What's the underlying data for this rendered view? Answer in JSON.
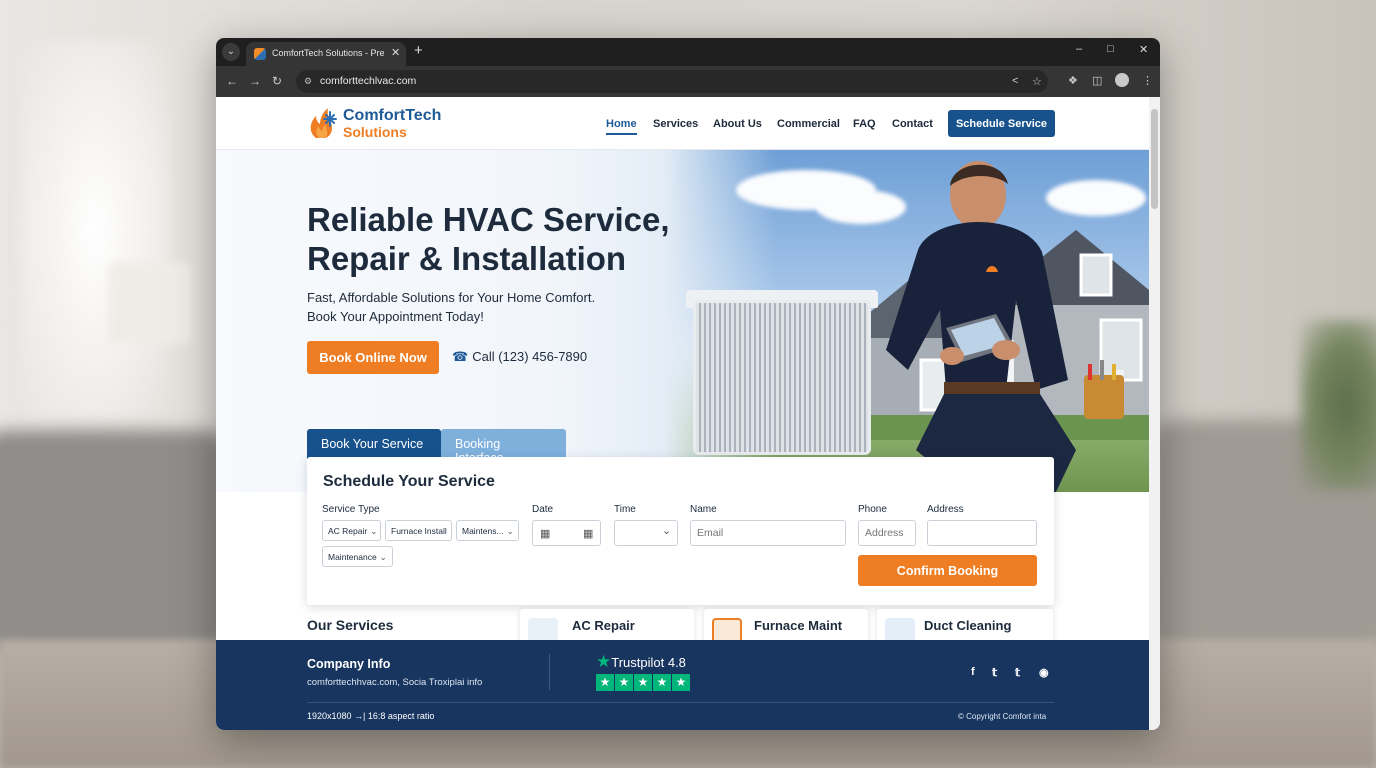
{
  "browser": {
    "tab_title": "ComfortTech Solutions - Premier",
    "url": "comforttechlvac.com"
  },
  "brand": {
    "name_line1": "ComfortTech",
    "name_line2": "Solutions",
    "primary_color": "#17528d",
    "accent_color": "#ef7d23"
  },
  "nav": {
    "items": [
      "Home",
      "Services",
      "About Us",
      "Commercial",
      "FAQ",
      "Contact"
    ],
    "active": "Home",
    "cta_label": "Schedule Service"
  },
  "hero": {
    "headline_line1": "Reliable HVAC Service,",
    "headline_line2": "Repair & Installation",
    "subtext_line1": "Fast, Affordable Solutions for Your Home Comfort.",
    "subtext_line2": "Book Your Appointment Today!",
    "book_label": "Book Online Now",
    "call_label": "Call (123) 456-7890"
  },
  "booking": {
    "tabs": [
      "Book Your Service",
      "Booking Interface"
    ],
    "card_title": "Schedule Your Service",
    "labels": {
      "service_type": "Service Type",
      "date": "Date",
      "time": "Time",
      "name": "Name",
      "phone": "Phone",
      "address": "Address"
    },
    "service_options": [
      "AC Repair",
      "Furnace Install",
      "Maintens...",
      "Maintenance"
    ],
    "name_placeholder": "Email",
    "phone_placeholder": "Address",
    "confirm_label": "Confirm Booking"
  },
  "services": {
    "title": "Our Services",
    "items": [
      "AC Repair",
      "Furnace Maint",
      "Duct Cleaning"
    ]
  },
  "footer": {
    "company_title": "Company Info",
    "company_text": "comforttechhvac.com, Socia Troxiplai info",
    "trustpilot_label": "Trustpilot 4.8",
    "trustpilot_rating": 4.8,
    "resolution_text": "1920x1080 →| 16:8 aspect ratio",
    "copyright": "© Copyright Comfort inta",
    "social_icons": [
      "facebook-icon",
      "twitter-icon",
      "twitter-icon",
      "instagram-icon"
    ]
  }
}
